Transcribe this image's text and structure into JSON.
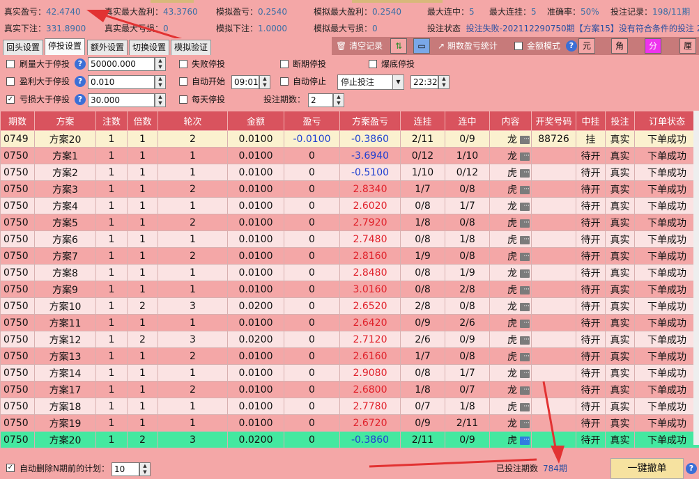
{
  "stats": {
    "real_profit_label": "真实盈亏：",
    "real_profit_value": "42.4740",
    "real_max_profit_label": "真实最大盈利：",
    "real_max_profit_value": "43.3760",
    "sim_profit_label": "模拟盈亏：",
    "sim_profit_value": "0.2540",
    "sim_max_profit_label": "模拟最大盈利：",
    "sim_max_profit_value": "0.2540",
    "max_consec_hit_label": "最大连中：",
    "max_consec_hit_value": "5",
    "max_consec_miss_label": "最大连挂：",
    "max_consec_miss_value": "5",
    "accuracy_label": "准确率：",
    "accuracy_value": "50%",
    "bet_record_label": "投注记录：",
    "bet_record_value": "198/11期",
    "real_bet_label": "真实下注：",
    "real_bet_value": "331.8900",
    "real_max_loss_label": "真实最大亏损：",
    "real_max_loss_value": "0",
    "sim_bet_label": "模拟下注：",
    "sim_bet_value": "1.0000",
    "sim_max_loss_label": "模拟最大亏损：",
    "sim_max_loss_value": "0",
    "bet_status_label": "投注状态",
    "bet_status_value": "投注失败-202112290750期【方案15】没有符合条件的投注 20"
  },
  "tabs": [
    "回头设置",
    "停投设置",
    "额外设置",
    "切换设置",
    "模拟验证"
  ],
  "toolbar": {
    "clear_label": "清空记录",
    "stats_label": "期数盈亏统计",
    "amount_mode_label": "金额模式",
    "unit_yuan": "元",
    "unit_jiao": "角",
    "unit_fen": "分",
    "unit_li": "厘"
  },
  "settings": {
    "brush_label": "刷量大于停投",
    "brush_value": "50000.000",
    "profit_label": "盈利大于停投",
    "profit_value": "0.010",
    "loss_label": "亏损大于停投",
    "loss_value": "30.000",
    "fail_stop_label": "失败停投",
    "auto_start_label": "自动开始",
    "auto_start_time": "09:01",
    "daily_stop_label": "每天停投",
    "break_stop_label": "断期停投",
    "auto_stop_label": "自动停止",
    "auto_stop_mode": "停止投注",
    "auto_stop_time": "22:32",
    "bet_periods_label": "投注期数：",
    "bet_periods_value": "2",
    "crash_stop_label": "爆底停投"
  },
  "table": {
    "headers": [
      "期数",
      "方案",
      "注数",
      "倍数",
      "轮次",
      "金额",
      "盈亏",
      "方案盈亏",
      "连挂",
      "连中",
      "内容",
      "开奖号码",
      "中挂",
      "投注",
      "订单状态"
    ],
    "rows": [
      [
        "0749",
        "方案20",
        "1",
        "1",
        "2",
        "0.0100",
        "-0.0100",
        "-0.3860",
        "2/11",
        "0/9",
        "龙",
        "88726",
        "挂",
        "真实",
        "下单成功"
      ],
      [
        "0750",
        "方案1",
        "1",
        "1",
        "1",
        "0.0100",
        "0",
        "-3.6940",
        "0/12",
        "1/10",
        "龙",
        "",
        "待开",
        "真实",
        "下单成功"
      ],
      [
        "0750",
        "方案2",
        "1",
        "1",
        "1",
        "0.0100",
        "0",
        "-0.5100",
        "1/10",
        "0/12",
        "虎",
        "",
        "待开",
        "真实",
        "下单成功"
      ],
      [
        "0750",
        "方案3",
        "1",
        "1",
        "2",
        "0.0100",
        "0",
        "2.8340",
        "1/7",
        "0/8",
        "虎",
        "",
        "待开",
        "真实",
        "下单成功"
      ],
      [
        "0750",
        "方案4",
        "1",
        "1",
        "1",
        "0.0100",
        "0",
        "2.6020",
        "0/8",
        "1/7",
        "龙",
        "",
        "待开",
        "真实",
        "下单成功"
      ],
      [
        "0750",
        "方案5",
        "1",
        "1",
        "2",
        "0.0100",
        "0",
        "2.7920",
        "1/8",
        "0/8",
        "虎",
        "",
        "待开",
        "真实",
        "下单成功"
      ],
      [
        "0750",
        "方案6",
        "1",
        "1",
        "1",
        "0.0100",
        "0",
        "2.7480",
        "0/8",
        "1/8",
        "虎",
        "",
        "待开",
        "真实",
        "下单成功"
      ],
      [
        "0750",
        "方案7",
        "1",
        "1",
        "2",
        "0.0100",
        "0",
        "2.8160",
        "1/9",
        "0/8",
        "虎",
        "",
        "待开",
        "真实",
        "下单成功"
      ],
      [
        "0750",
        "方案8",
        "1",
        "1",
        "1",
        "0.0100",
        "0",
        "2.8480",
        "0/8",
        "1/9",
        "龙",
        "",
        "待开",
        "真实",
        "下单成功"
      ],
      [
        "0750",
        "方案9",
        "1",
        "1",
        "1",
        "0.0100",
        "0",
        "3.0160",
        "0/8",
        "2/8",
        "虎",
        "",
        "待开",
        "真实",
        "下单成功"
      ],
      [
        "0750",
        "方案10",
        "1",
        "2",
        "3",
        "0.0200",
        "0",
        "2.6520",
        "2/8",
        "0/8",
        "龙",
        "",
        "待开",
        "真实",
        "下单成功"
      ],
      [
        "0750",
        "方案11",
        "1",
        "1",
        "1",
        "0.0100",
        "0",
        "2.6420",
        "0/9",
        "2/6",
        "虎",
        "",
        "待开",
        "真实",
        "下单成功"
      ],
      [
        "0750",
        "方案12",
        "1",
        "2",
        "3",
        "0.0200",
        "0",
        "2.7120",
        "2/6",
        "0/9",
        "虎",
        "",
        "待开",
        "真实",
        "下单成功"
      ],
      [
        "0750",
        "方案13",
        "1",
        "1",
        "2",
        "0.0100",
        "0",
        "2.6160",
        "1/7",
        "0/8",
        "虎",
        "",
        "待开",
        "真实",
        "下单成功"
      ],
      [
        "0750",
        "方案14",
        "1",
        "1",
        "1",
        "0.0100",
        "0",
        "2.9080",
        "0/8",
        "1/7",
        "龙",
        "",
        "待开",
        "真实",
        "下单成功"
      ],
      [
        "0750",
        "方案17",
        "1",
        "1",
        "2",
        "0.0100",
        "0",
        "2.6800",
        "1/8",
        "0/7",
        "龙",
        "",
        "待开",
        "真实",
        "下单成功"
      ],
      [
        "0750",
        "方案18",
        "1",
        "1",
        "1",
        "0.0100",
        "0",
        "2.7780",
        "0/7",
        "1/8",
        "虎",
        "",
        "待开",
        "真实",
        "下单成功"
      ],
      [
        "0750",
        "方案19",
        "1",
        "1",
        "1",
        "0.0100",
        "0",
        "2.6720",
        "0/9",
        "2/11",
        "龙",
        "",
        "待开",
        "真实",
        "下单成功"
      ],
      [
        "0750",
        "方案20",
        "1",
        "2",
        "3",
        "0.0200",
        "0",
        "-0.3860",
        "2/11",
        "0/9",
        "虎",
        "",
        "待开",
        "真实",
        "下单成功"
      ]
    ]
  },
  "bottom": {
    "auto_delete_label": "自动删除N期前的计划：",
    "auto_delete_value": "10",
    "bet_periods_label": "已投注期数",
    "bet_periods_value": "784期",
    "cancel_all_label": "一键撤单"
  },
  "colors": {
    "background": "#f4a7a7",
    "header": "#d9535e",
    "selected_row": "#44e8a0",
    "negative": "#1f3fd1",
    "positive": "#e0202a"
  }
}
